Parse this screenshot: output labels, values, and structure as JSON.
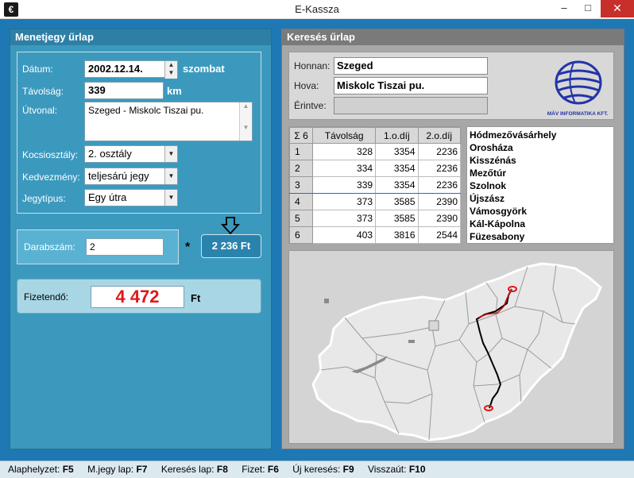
{
  "window": {
    "title": "E-Kassza",
    "min": "–",
    "max": "□",
    "close": "✕"
  },
  "left": {
    "header": "Menetjegy űrlap",
    "datum_label": "Dátum:",
    "datum_value": "2002.12.14.",
    "datum_day": "szombat",
    "tavolsag_label": "Távolság:",
    "tavolsag_value": "339",
    "tavolsag_unit": "km",
    "utvonal_label": "Útvonal:",
    "utvonal_value": "Szeged - Miskolc Tiszai pu.",
    "kocsiosztaly_label": "Kocsiosztály:",
    "kocsiosztaly_value": "2. osztály",
    "kedvezmeny_label": "Kedvezmény:",
    "kedvezmeny_value": "teljesárú jegy",
    "jegytipus_label": "Jegytípus:",
    "jegytipus_value": "Egy útra",
    "darabszam_label": "Darabszám:",
    "darabszam_value": "2",
    "star": "*",
    "unit_price": "2 236 Ft",
    "fizetendo_label": "Fizetendő:",
    "fizetendo_value": "4 472",
    "fizetendo_unit": "Ft"
  },
  "right": {
    "header": "Keresés űrlap",
    "honnan_label": "Honnan:",
    "honnan_value": "Szeged",
    "hova_label": "Hova:",
    "hova_value": "Miskolc Tiszai pu.",
    "erintve_label": "Érintve:",
    "erintve_value": "",
    "logo_text": "MÁV INFORMATIKA KFT.",
    "table": {
      "headers": [
        "Σ 6",
        "Távolság",
        "1.o.díj",
        "2.o.díj"
      ],
      "rows": [
        [
          "1",
          "328",
          "3354",
          "2236"
        ],
        [
          "2",
          "334",
          "3354",
          "2236"
        ],
        [
          "3",
          "339",
          "3354",
          "2236"
        ],
        [
          "4",
          "373",
          "3585",
          "2390"
        ],
        [
          "5",
          "373",
          "3585",
          "2390"
        ],
        [
          "6",
          "403",
          "3816",
          "2544"
        ]
      ],
      "selected_row": 3
    },
    "stations": [
      "Hódmezővásárhely",
      "Orosháza",
      "Kisszénás",
      "Mezőtúr",
      "Szolnok",
      "Újszász",
      "Vámosgyörk",
      "Kál-Kápolna",
      "Füzesabony"
    ]
  },
  "statusbar": [
    {
      "label": "Alaphelyzet:",
      "key": "F5"
    },
    {
      "label": "M.jegy lap:",
      "key": "F7"
    },
    {
      "label": "Keresés lap:",
      "key": "F8"
    },
    {
      "label": "Fizet:",
      "key": "F6"
    },
    {
      "label": "Új keresés:",
      "key": "F9"
    },
    {
      "label": "Visszaút:",
      "key": "F10"
    }
  ]
}
